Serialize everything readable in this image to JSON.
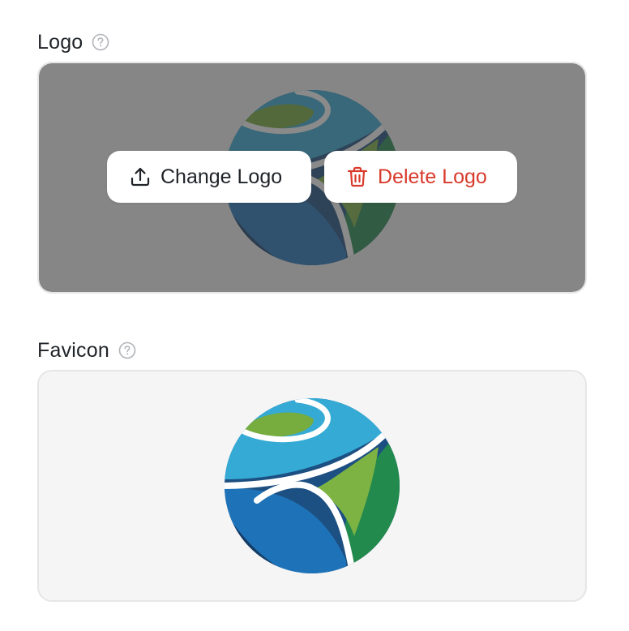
{
  "logo": {
    "label": "Logo",
    "change_label": "Change Logo",
    "delete_label": "Delete Logo",
    "icons": {
      "help": "help-circle-icon",
      "change": "upload-icon",
      "delete": "trash-icon"
    }
  },
  "favicon": {
    "label": "Favicon",
    "icons": {
      "help": "help-circle-icon"
    }
  },
  "colors": {
    "delete_text": "#d93a2b",
    "overlay": "rgba(60,60,60,0.6)",
    "logo_blue_light": "#2fa8d1",
    "logo_blue_dark": "#1d6fb0",
    "logo_green_light": "#7bb342",
    "logo_green_dark": "#23894f"
  }
}
